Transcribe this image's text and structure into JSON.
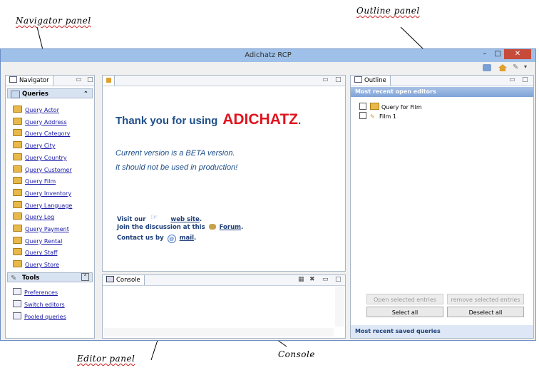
{
  "annotations": {
    "navigator": "Navigator panel",
    "outline": "Outline panel",
    "editor": "Editor panel",
    "console": "Console"
  },
  "window": {
    "title": "Adichatz RCP",
    "minimize": "–",
    "maximize": "□",
    "close": "✕"
  },
  "navigator": {
    "tab_label": "Navigator",
    "queries_header": "Queries",
    "queries": [
      "Query Actor",
      "Query Address",
      "Query Category",
      "Query City",
      "Query Country",
      "Query Customer",
      "Query Film",
      "Query Inventory",
      "Query Language",
      "Query Log",
      "Query Payment",
      "Query Rental",
      "Query Staff",
      "Query Store"
    ],
    "tools_header": "Tools",
    "tools": [
      "Preferences",
      "Switch editors",
      "Pooled queries"
    ]
  },
  "editor": {
    "thank_you": "Thank you for using",
    "brand": "ADICHATZ",
    "brand_dot": ".",
    "beta_line1": "Current version is a BETA version.",
    "beta_line2": "It should not be used in production!",
    "visit_prefix": "Visit our",
    "web_site": "web site",
    "join_prefix": "Join the discussion at this",
    "forum": "Forum",
    "contact_prefix": "Contact us by",
    "mail": "mail",
    "period": ".",
    "brand_color": "#e0141e",
    "text_color": "#1f4f8a"
  },
  "console": {
    "tab_label": "Console"
  },
  "outline": {
    "tab_label": "Outline",
    "recent_open_header": "Most recent open editors",
    "entries": [
      "Query for Film",
      "Film 1"
    ],
    "open_selected": "Open selected entries",
    "remove_selected": "remove selected entries",
    "select_all": "Select all",
    "deselect_all": "Deselect all",
    "recent_saved": "Most recent saved queries"
  }
}
